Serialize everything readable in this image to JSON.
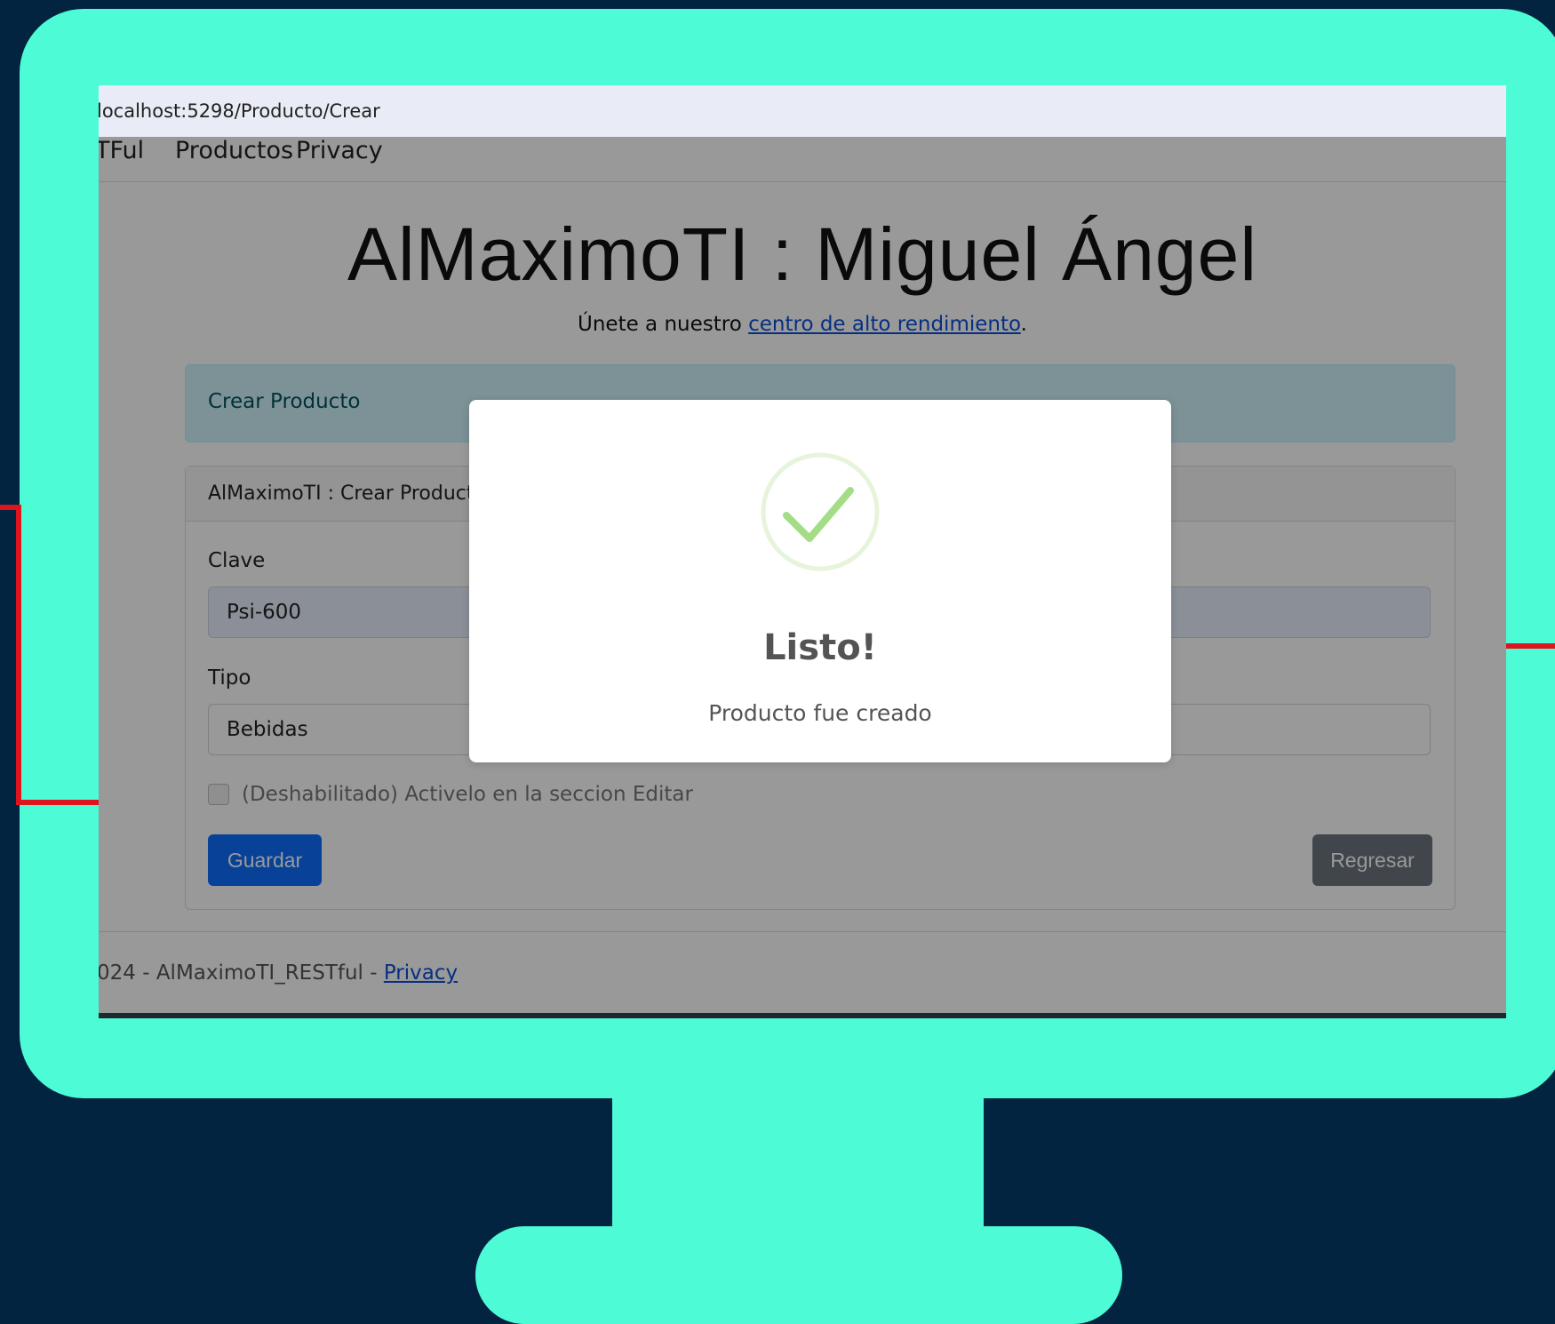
{
  "browser": {
    "url": "localhost:5298/Producto/Crear"
  },
  "navbar": {
    "brand": "TFul",
    "items": [
      "Productos",
      "Privacy"
    ]
  },
  "header": {
    "title": "AlMaximoTI : Miguel Ángel",
    "subtitle_prefix": "Únete a nuestro ",
    "subtitle_link": "centro de alto rendimiento",
    "subtitle_suffix": "."
  },
  "alert": {
    "text": "Crear Producto"
  },
  "form": {
    "card_title": "AlMaximoTI : Crear Producto",
    "clave_label": "Clave",
    "clave_value": "Psi-600",
    "tipo_label": "Tipo",
    "tipo_value": "Bebidas",
    "checkbox_label": "(Deshabilitado) Activelo en la seccion Editar",
    "save_label": "Guardar",
    "back_label": "Regresar"
  },
  "footer": {
    "text": "024 - AlMaximoTI_RESTful - ",
    "link": "Privacy"
  },
  "modal": {
    "icon": "success-check-icon",
    "title": "Listo!",
    "text": "Producto fue creado"
  },
  "colors": {
    "frame": "#4dfcd6",
    "background": "#022440",
    "accent_line": "#e0141c",
    "primary": "#0d6efd",
    "success": "#a5dc86"
  }
}
